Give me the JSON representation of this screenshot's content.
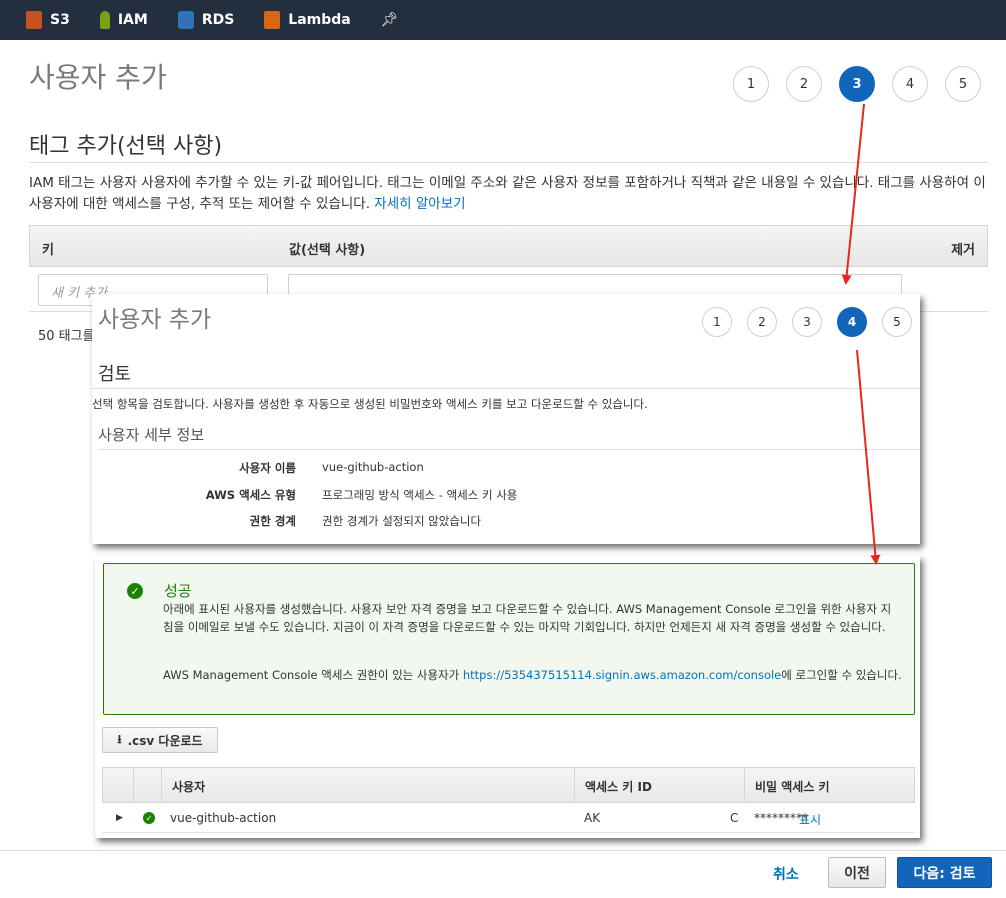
{
  "nav": {
    "items": [
      {
        "label": "S3",
        "icon": "s3-icon"
      },
      {
        "label": "IAM",
        "icon": "iam-icon"
      },
      {
        "label": "RDS",
        "icon": "rds-icon"
      },
      {
        "label": "Lambda",
        "icon": "lambda-icon"
      }
    ],
    "pin_icon": "pin-icon"
  },
  "page": {
    "title": "사용자 추가",
    "steps": [
      "1",
      "2",
      "3",
      "4",
      "5"
    ],
    "active_step": "3",
    "section_title": "태그 추가(선택 사항)",
    "description": "IAM 태그는 사용자 사용자에 추가할 수 있는 키-값 페어입니다. 태그는 이메일 주소와 같은 사용자 정보를 포함하거나 직책과 같은 내용일 수 있습니다. 태그를 사용하여 이 사용자에 대한 액세스를 구성, 추적 또는 제어할 수 있습니다.",
    "learn_more": "자세히 알아보기",
    "table": {
      "col_key": "키",
      "col_value": "값(선택 사항)",
      "col_remove": "제거",
      "key_placeholder": "새 키 추가"
    },
    "tag_count": "50 태그를"
  },
  "review": {
    "title": "사용자 추가",
    "steps": [
      "1",
      "2",
      "3",
      "4",
      "5"
    ],
    "active_step": "4",
    "section_title": "검토",
    "description": "선택 항목을 검토합니다. 사용자를 생성한 후 자동으로 생성된 비밀번호와 액세스 키를 보고 다운로드할 수 있습니다.",
    "details_title": "사용자 세부 정보",
    "rows": [
      {
        "label": "사용자 이름",
        "value": "vue-github-action"
      },
      {
        "label": "AWS 액세스 유형",
        "value": "프로그래밍 방식 액세스 - 액세스 키 사용"
      },
      {
        "label": "권한 경계",
        "value": "권한 경계가 설정되지 않았습니다"
      }
    ]
  },
  "success": {
    "title": "성공",
    "body": "아래에 표시된 사용자를 생성했습니다. 사용자 보안 자격 증명을 보고 다운로드할 수 있습니다. AWS Management Console 로그인을 위한 사용자 지침을 이메일로 보낼 수도 있습니다. 지금이 이 자격 증명을 다운로드할 수 있는 마지막 기회입니다. 하지만 언제든지 새 자격 증명을 생성할 수 있습니다.",
    "console_prefix": "AWS Management Console 액세스 권한이 있는 사용자가 ",
    "console_url": "https://535437515114.signin.aws.amazon.com/console",
    "console_suffix": "에 로그인할 수 있습니다.",
    "csv_button": ".csv 다운로드",
    "table": {
      "col_user": "사용자",
      "col_access_key": "액세스 키 ID",
      "col_secret": "비밀 액세스 키",
      "rows": [
        {
          "user": "vue-github-action",
          "access_key_start": "AK",
          "access_key_end": "C",
          "secret_mask": "*********",
          "show": "표시"
        }
      ]
    }
  },
  "footer": {
    "cancel": "취소",
    "previous": "이전",
    "next": "다음: 검토"
  },
  "colors": {
    "nav_bg": "#232f3e",
    "primary": "#1166bb",
    "link": "#0073bb",
    "success": "#1d8102",
    "arrow": "#e8261c"
  }
}
